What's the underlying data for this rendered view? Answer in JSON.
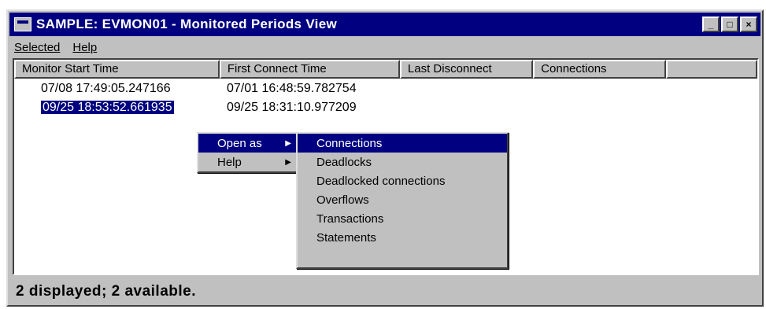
{
  "window": {
    "title": "SAMPLE: EVMON01 - Monitored Periods View",
    "controls": [
      "_",
      "□",
      "×"
    ]
  },
  "menubar": {
    "items": [
      "Selected",
      "Help"
    ]
  },
  "list": {
    "columns": [
      "Monitor Start Time",
      "First Connect Time",
      "Last Disconnect",
      "Connections",
      ""
    ],
    "rows": [
      {
        "start": "07/08 17:49:05.247166",
        "first_connect": "07/01 16:48:59.782754",
        "selected": false
      },
      {
        "start": "09/25 18:53:52.661935",
        "first_connect": "09/25 18:31:10.977209",
        "selected": true
      }
    ]
  },
  "context_menu": {
    "items": [
      "Open as",
      "Help"
    ]
  },
  "submenu": {
    "items": [
      "Connections",
      "Deadlocks",
      "Deadlocked connections",
      "Overflows",
      "Transactions",
      "Statements"
    ]
  },
  "status": {
    "text": "2 displayed; 2 available."
  }
}
